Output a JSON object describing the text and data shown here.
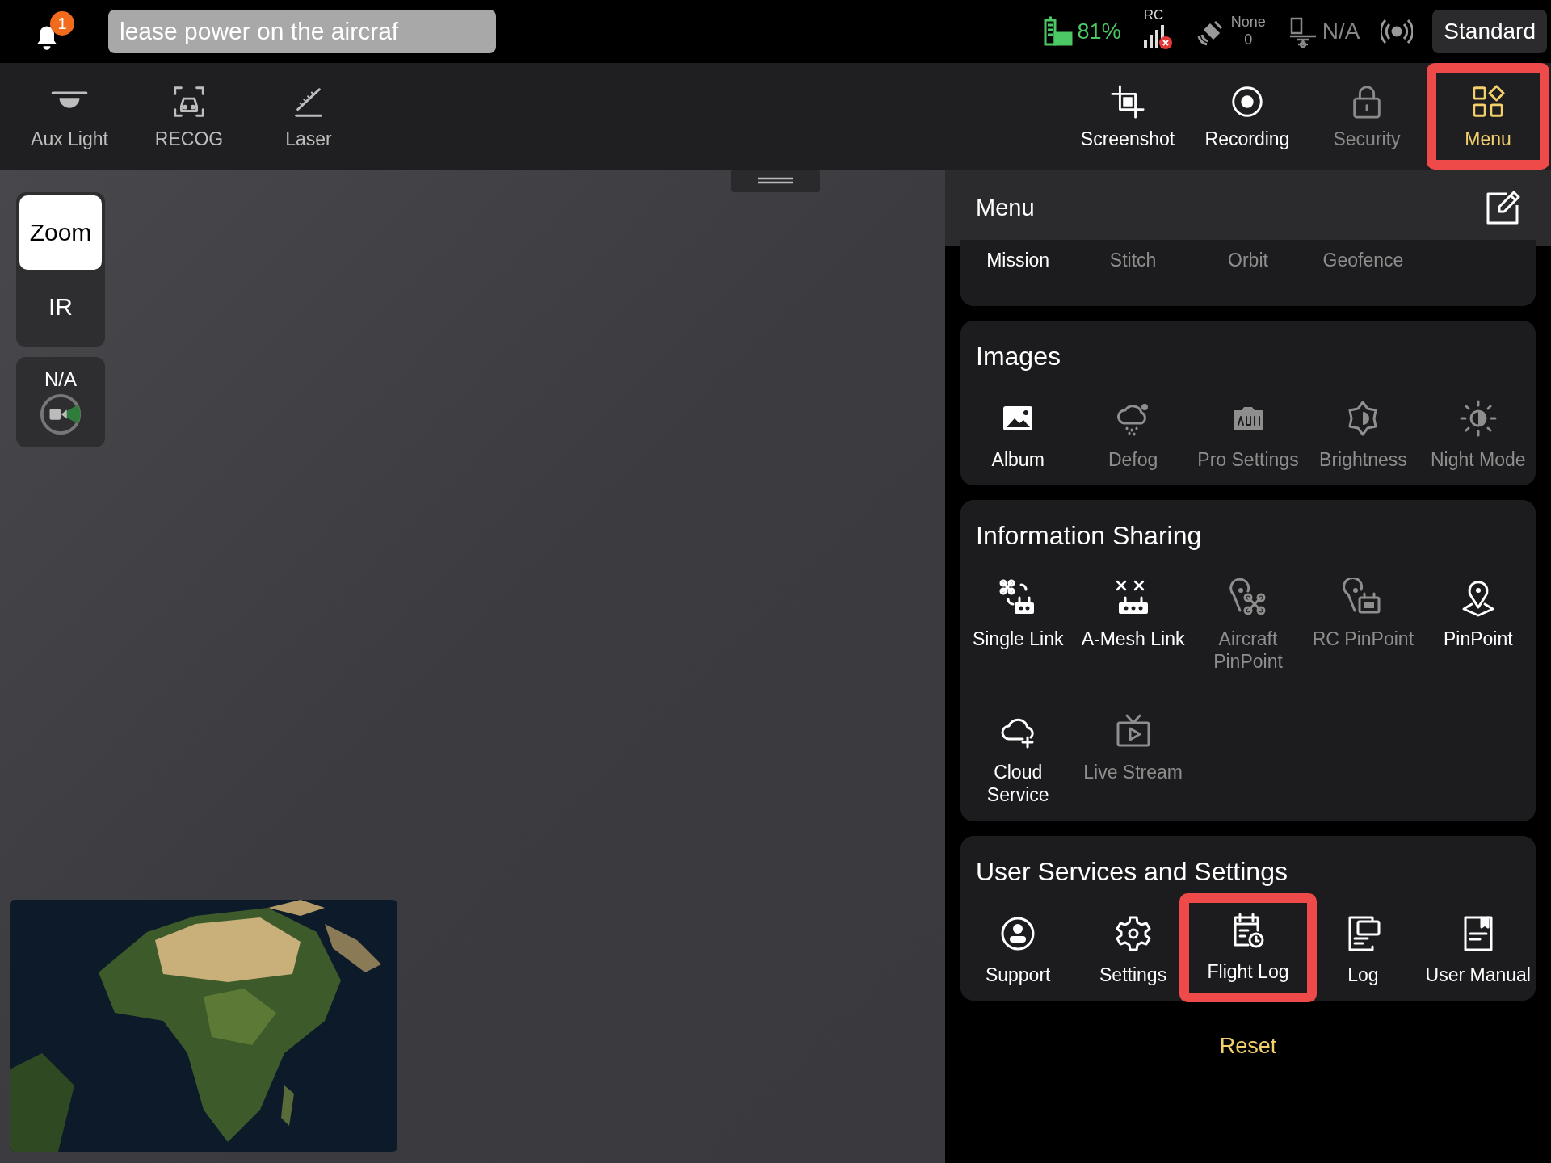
{
  "notifications": {
    "count": "1"
  },
  "banner": {
    "text": "lease power on the aircraf"
  },
  "status": {
    "battery": "81%",
    "rc_label": "RC",
    "gps_status": "None",
    "gps_count": "0",
    "aircraft_battery": "N/A",
    "mode_button": "Standard"
  },
  "left_tools": [
    {
      "label": "Aux Light",
      "disabled": false
    },
    {
      "label": "RECOG",
      "disabled": false
    },
    {
      "label": "Laser",
      "disabled": false
    }
  ],
  "right_tools": [
    {
      "label": "Screenshot",
      "disabled": false,
      "selected": false,
      "highlighted": false
    },
    {
      "label": "Recording",
      "disabled": false,
      "selected": false,
      "highlighted": false
    },
    {
      "label": "Security",
      "disabled": true,
      "selected": false,
      "highlighted": false
    },
    {
      "label": "Menu",
      "disabled": false,
      "selected": true,
      "highlighted": true
    }
  ],
  "lenses": [
    {
      "label": "Zoom",
      "selected": true
    },
    {
      "label": "IR",
      "selected": false
    }
  ],
  "aux_camera": {
    "label": "N/A"
  },
  "panel": {
    "title": "Menu",
    "sections": [
      {
        "items": [
          {
            "label": "Mission",
            "disabled": false,
            "highlighted": false
          },
          {
            "label": "Stitch",
            "disabled": true,
            "highlighted": false
          },
          {
            "label": "Orbit",
            "disabled": true,
            "highlighted": false
          },
          {
            "label": "Geofence",
            "disabled": true,
            "highlighted": false
          }
        ]
      },
      {
        "title": "Images",
        "items": [
          {
            "label": "Album",
            "disabled": false,
            "highlighted": false
          },
          {
            "label": "Defog",
            "disabled": true,
            "highlighted": false
          },
          {
            "label": "Pro Settings",
            "disabled": true,
            "highlighted": false
          },
          {
            "label": "Brightness",
            "disabled": true,
            "highlighted": false
          },
          {
            "label": "Night Mode",
            "disabled": true,
            "highlighted": false
          }
        ]
      },
      {
        "title": "Information Sharing",
        "items": [
          {
            "label": "Single Link",
            "disabled": false,
            "highlighted": false
          },
          {
            "label": "A-Mesh Link",
            "disabled": false,
            "highlighted": false
          },
          {
            "label": "Aircraft PinPoint",
            "disabled": true,
            "highlighted": false
          },
          {
            "label": "RC PinPoint",
            "disabled": true,
            "highlighted": false
          },
          {
            "label": "PinPoint",
            "disabled": false,
            "highlighted": false
          },
          {
            "label": "Cloud Service",
            "disabled": false,
            "highlighted": false
          },
          {
            "label": "Live Stream",
            "disabled": true,
            "highlighted": false
          }
        ]
      },
      {
        "title": "User Services and Settings",
        "items": [
          {
            "label": "Support",
            "disabled": false,
            "highlighted": false
          },
          {
            "label": "Settings",
            "disabled": false,
            "highlighted": false
          },
          {
            "label": "Flight Log",
            "disabled": false,
            "highlighted": true
          },
          {
            "label": "Log",
            "disabled": false,
            "highlighted": false
          },
          {
            "label": "User Manual",
            "disabled": false,
            "highlighted": false
          }
        ]
      }
    ],
    "reset": "Reset"
  }
}
